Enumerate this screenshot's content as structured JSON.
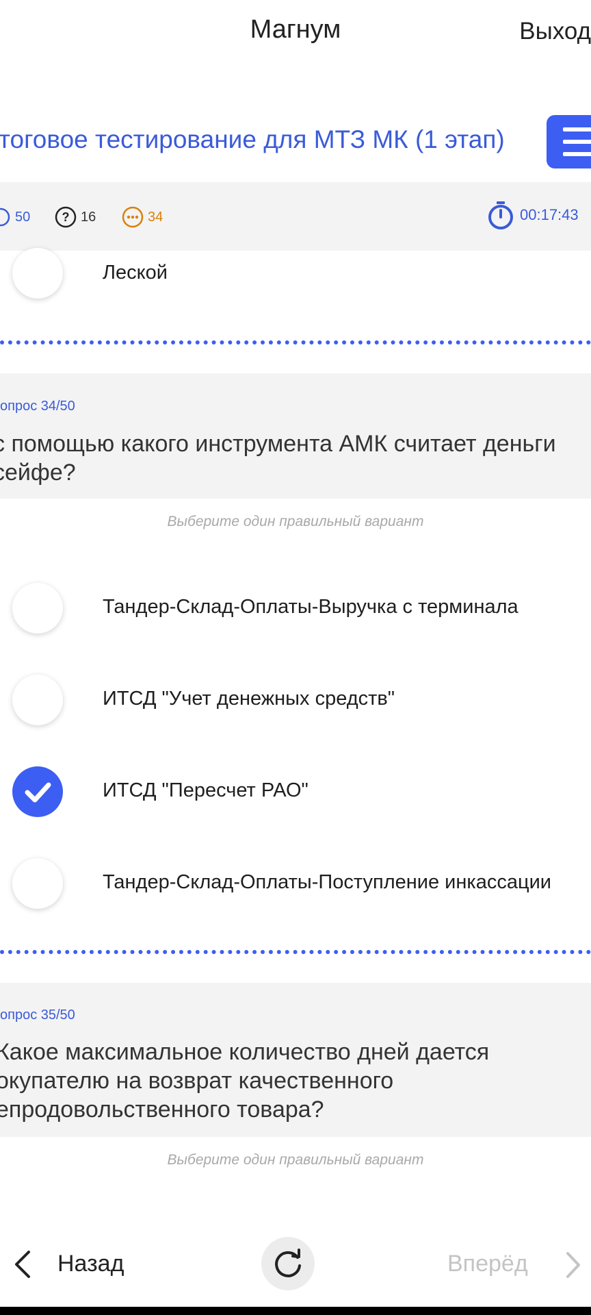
{
  "header": {
    "app_title": "Магнум",
    "exit_label": "Выход"
  },
  "test": {
    "title": "тоговое тестирование для МТЗ МК (1 этап)"
  },
  "stats": {
    "total": "50",
    "unanswered": "16",
    "answered": "34",
    "timer": "00:17:43"
  },
  "prev_answer": {
    "label": "Леской"
  },
  "questions": [
    {
      "number": "опрос 34/50",
      "text_lines": [
        "с помощью какого инструмента АМК считает деньги",
        "сейфе?"
      ],
      "hint": "Выберите один правильный вариант",
      "options": [
        {
          "label": "Тандер-Склад-Оплаты-Выручка с терминала",
          "selected": false
        },
        {
          "label": "ИТСД \"Учет денежных средств\"",
          "selected": false
        },
        {
          "label": "ИТСД \"Пересчет РАО\"",
          "selected": true
        },
        {
          "label": "Тандер-Склад-Оплаты-Поступление инкассации",
          "selected": false
        }
      ]
    },
    {
      "number": "опрос 35/50",
      "text_lines": [
        "Какое максимальное количество дней дается",
        "окупателю на возврат качественного",
        "епродовольственного товара?"
      ],
      "hint": "Выберите один правильный вариант"
    }
  ],
  "footer": {
    "back_label": "Назад",
    "next_label": "Вперёд"
  },
  "colors": {
    "accent": "#3d5ef2",
    "text_link": "#3a5bd9",
    "warning": "#d9800a",
    "disabled": "#c4c4c4"
  },
  "icons": [
    "check-icon",
    "question-icon",
    "dots-icon",
    "stopwatch-icon",
    "menu-icon",
    "chevron-left-icon",
    "refresh-icon",
    "chevron-right-icon",
    "checkmark-icon"
  ]
}
